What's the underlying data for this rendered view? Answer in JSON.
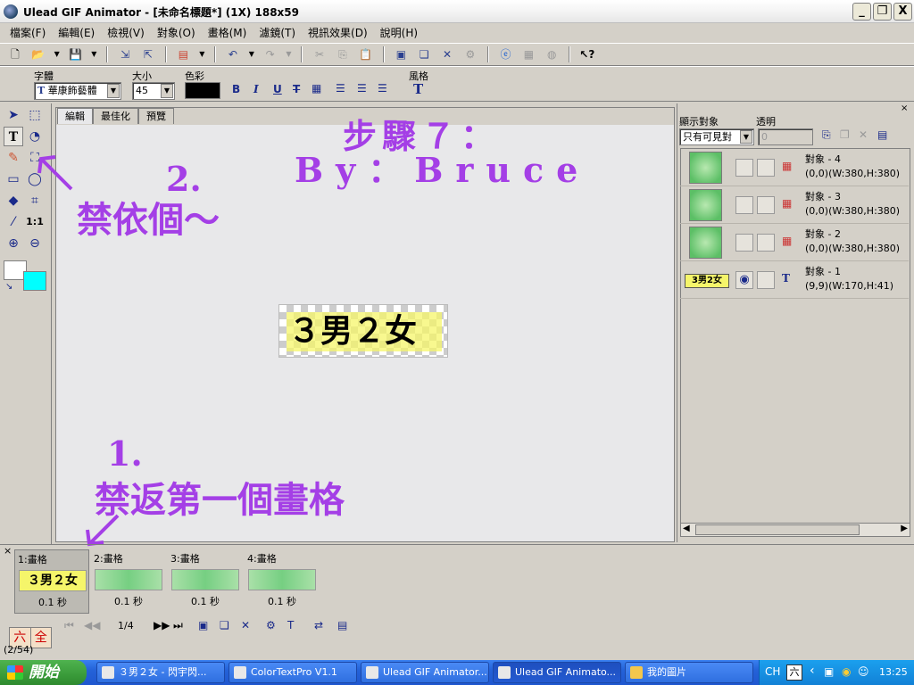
{
  "window": {
    "title": "Ulead GIF Animator - [未命名標題*] (1X) 188x59",
    "buttons": {
      "minimize": "_",
      "restore": "❐",
      "close": "X"
    }
  },
  "menu": [
    "檔案(F)",
    "編輯(E)",
    "檢視(V)",
    "對象(O)",
    "畫格(M)",
    "濾鏡(T)",
    "視訊效果(D)",
    "說明(H)"
  ],
  "textbar": {
    "font_label": "字體",
    "font_value": "華康飾藝體",
    "size_label": "大小",
    "size_value": "45",
    "color_label": "色彩",
    "color_value": "#000000",
    "style_label": "風格",
    "bold": "B",
    "italic": "I",
    "underline": "U",
    "strike": "T"
  },
  "tabs": [
    "編輯",
    "最佳化",
    "預覽"
  ],
  "canvas": {
    "text": "３男２女"
  },
  "annotations": {
    "step": "步驟７：",
    "author": "By：Bruce",
    "num2": "2.",
    "note2": "禁依個～",
    "num1": "1.",
    "note1": "禁返第一個畫格"
  },
  "right_panel": {
    "show_label": "顯示對象",
    "opacity_label": "透明",
    "filter_value": "只有可見對",
    "opacity_value": "0",
    "objects": [
      {
        "name": "對象 - 4",
        "info": "(0,0)(W:380,H:380)",
        "type": "image"
      },
      {
        "name": "對象 - 3",
        "info": "(0,0)(W:380,H:380)",
        "type": "image"
      },
      {
        "name": "對象 - 2",
        "info": "(0,0)(W:380,H:380)",
        "type": "image"
      },
      {
        "name": "對象 - 1",
        "info": "(9,9)(W:170,H:41)",
        "type": "text",
        "thumb_text": "3男2女"
      }
    ]
  },
  "frames": [
    {
      "label": "1:畫格",
      "time": "0.1 秒",
      "thumb_text": "３男２女"
    },
    {
      "label": "2:畫格",
      "time": "0.1 秒"
    },
    {
      "label": "3:畫格",
      "time": "0.1 秒"
    },
    {
      "label": "4:畫格",
      "time": "0.1 秒"
    }
  ],
  "frame_counter": "1/4",
  "ime": {
    "a": "六",
    "b": "全"
  },
  "status": "(2/54)",
  "taskbar": {
    "start": "開始",
    "tasks": [
      "３男２女 - 閃宇閃...",
      "ColorTextPro V1.1",
      "Ulead GIF Animator...",
      "Ulead GIF Animato...",
      "我的圖片"
    ],
    "lang": "CH",
    "time": "13:25"
  },
  "colors": {
    "annotation": "#a43fe6",
    "secondary_color": "#00ffff",
    "text_highlight": "#f5f56a"
  }
}
